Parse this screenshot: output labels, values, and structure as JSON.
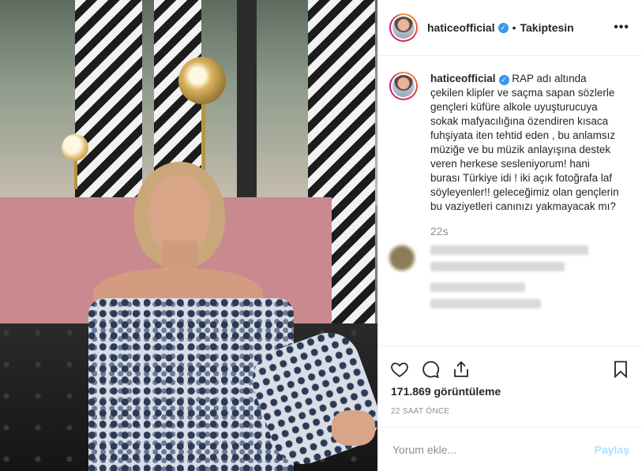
{
  "post": {
    "username": "haticeofficial",
    "verified_icon": "verified-badge-icon",
    "separator": "•",
    "follow_status": "Takiptesin",
    "more_label": "•••",
    "caption_text": " RAP adı altında çekilen klipler ve saçma sapan sözlerle gençleri küfüre alkole uyuşturucuya sokak mafyacılığına özendiren kısaca fuhşiyata iten tehtid eden , bu anlamsız müziğe ve bu müzik anlayışına destek veren herkese sesleniyorum! hani burası Türkiye idi ! iki açık fotoğrafa laf söyleyenler!! geleceğimiz olan gençlerin bu vaziyetleri canınızı yakmayacak mı?",
    "caption_time": "22s",
    "views": "171.869 görüntüleme",
    "date": "22 SAAT ÖNCE"
  },
  "comment_box": {
    "placeholder": "Yorum ekle...",
    "post_label": "Paylaş"
  },
  "icons": {
    "like": "heart-icon",
    "comment": "comment-icon",
    "share": "share-icon",
    "save": "bookmark-icon",
    "more": "more-options-icon"
  },
  "colors": {
    "verified": "#3897f0",
    "post_button": "#b2dffc",
    "muted_text": "#8e8e8e"
  }
}
